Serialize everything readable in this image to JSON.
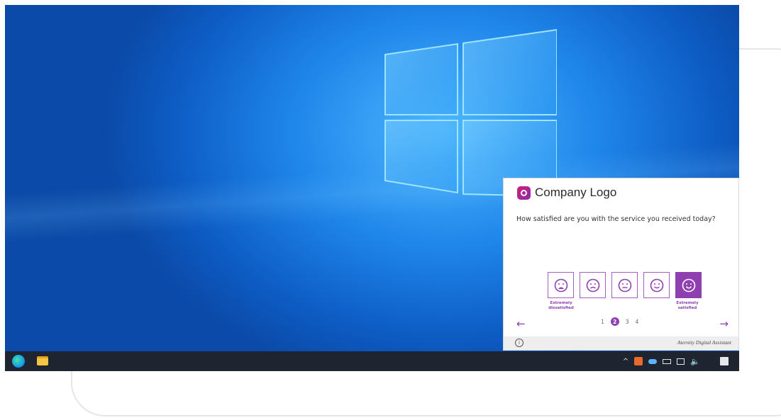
{
  "desktop": {
    "taskbar": {
      "icons": [
        "edge-icon",
        "file-explorer-icon"
      ],
      "tray_icons": [
        "up-arrow-icon",
        "app-tray-icon",
        "onedrive-cloud-icon",
        "battery-icon",
        "network-icon",
        "volume-icon",
        "notification-icon"
      ]
    }
  },
  "survey": {
    "brand_name": "Company Logo",
    "question": "How satisfied are you with the service you received today?",
    "ratings": [
      {
        "label": "Extremely dissatisfied",
        "icon": "very-sad-face-icon"
      },
      {
        "label": "",
        "icon": "sad-face-icon"
      },
      {
        "label": "",
        "icon": "neutral-face-icon"
      },
      {
        "label": "",
        "icon": "smile-face-icon"
      },
      {
        "label": "Extremely satisfied",
        "icon": "very-happy-face-icon",
        "selected": true
      }
    ],
    "label_left_line1": "Extremely",
    "label_left_line2": "dissatisfied",
    "label_right_line1": "Extremely",
    "label_right_line2": "satisfied",
    "pages": [
      "1",
      "2",
      "3",
      "4"
    ],
    "current_page": "2",
    "prev_arrow": "←",
    "next_arrow": "→",
    "footer_text": "Aternity Digital Assistant",
    "info_glyph": "i",
    "accent_color": "#8f3fb0"
  }
}
